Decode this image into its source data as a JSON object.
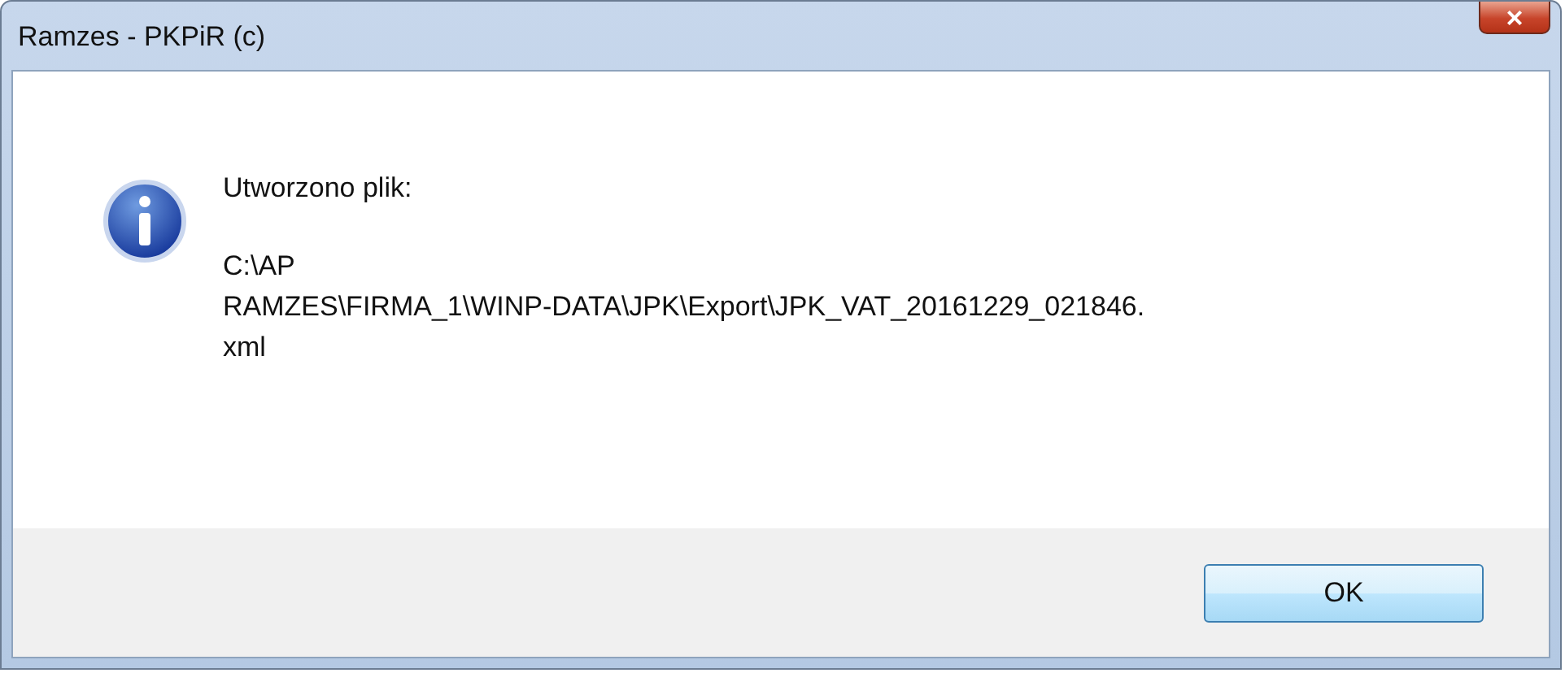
{
  "window": {
    "title": "Ramzes - PKPiR (c)",
    "close": "×"
  },
  "message": {
    "heading": "Utworzono plik:",
    "path_lines": [
      "C:\\AP",
      "RAMZES\\FIRMA_1\\WINP-DATA\\JPK\\Export\\JPK_VAT_20161229_021846.",
      "xml"
    ]
  },
  "buttons": [
    "OK"
  ]
}
